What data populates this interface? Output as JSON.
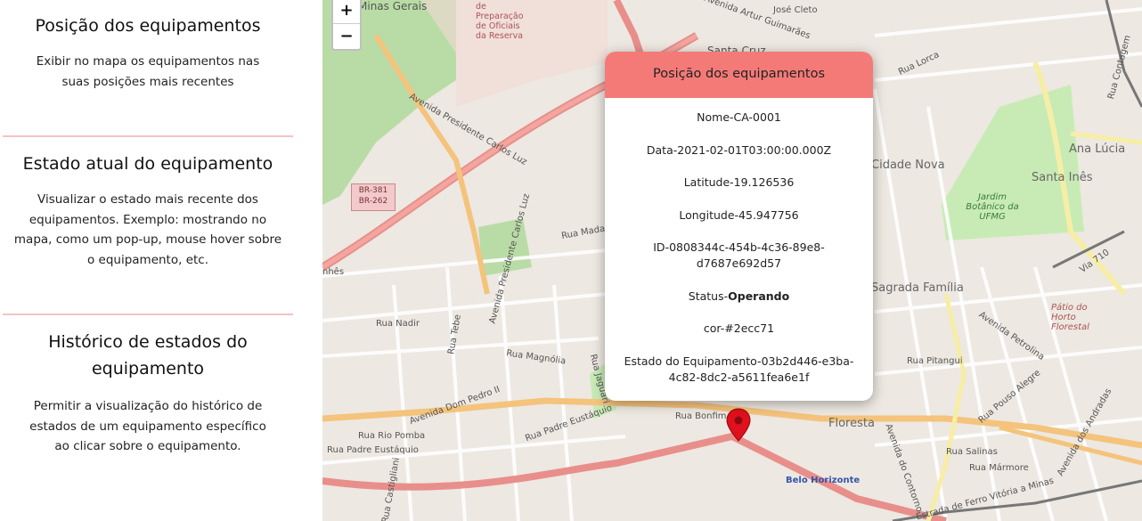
{
  "sidebar": {
    "sections": [
      {
        "title": "Posição dos equipamentos",
        "description": "Exibir no mapa os equipamentos nas suas posições mais recentes"
      },
      {
        "title": "Estado atual do equipamento",
        "description": "Visualizar o estado mais recente dos equipamentos. Exemplo: mostrando no mapa, como um pop-up, mouse hover sobre o equipamento, etc."
      },
      {
        "title": "Histórico de estados do equipamento",
        "description": "Permitir a visualização do histórico de estados de um equipamento específico ao clicar sobre o equipamento."
      }
    ]
  },
  "map": {
    "zoom_in": "+",
    "zoom_out": "−",
    "labels": {
      "minas_gerais": "Minas Gerais",
      "preparacao": "de Preparação de Oficiais da Reserva",
      "jose_cleto": "José Cleto",
      "artur": "Avenida Artur Guimarães",
      "santa_cruz": "Santa Cruz",
      "lorca": "Rua Lorca",
      "contagem": "Rua Contagem",
      "carlos_luz_1": "Avenida Presidente Carlos Luz",
      "carlos_luz_2": "Avenida Presidente Carlos Luz",
      "ana_lucia": "Ana Lúcia",
      "santa_ines": "Santa Inês",
      "cidade_nova": "Cidade Nova",
      "jardim": "Jardim Botânico da UFMG",
      "rua_madale": "Rua Madale",
      "sagrada": "Sagrada Família",
      "nadir": "Rua Nadir",
      "magnolia": "Rua Magnólia",
      "dom_pedro": "Avenida Dom Pedro II",
      "padre_eustaquio": "Rua Padre Eustáquio",
      "padre_eustaquio_2": "Rua Padre Eustáquio",
      "rio_pomba": "Rua Rio Pomba",
      "bonfim": "Rua Bonfim",
      "floresta": "Floresta",
      "petrolina": "Avenida Petrolina",
      "pitangui": "Rua Pitangui",
      "pouso_alegre": "Rua Pouso Alegre",
      "salinas": "Rua Salinas",
      "marmore": "Rua Mármore",
      "contorno": "Avenida do Contorno",
      "belo_horizonte": "Belo Horizonte",
      "patio": "Pátio do Horto Florestal",
      "ferrovia": "Estrada de Ferro Vitória a Minas",
      "via710": "Via 710",
      "andradas": "Avenida dos Andradas",
      "castigliani": "Rua Castigliani",
      "jaguari": "Rua Jaguari",
      "tebe": "Rua Tebe",
      "nhes": "nhês"
    },
    "badge": "BR-381 BR-262"
  },
  "popup": {
    "title": "Posição dos equipamentos",
    "rows": [
      {
        "label": "Nome",
        "sep": "-",
        "value": "CA-0001"
      },
      {
        "label": "Data",
        "sep": "-",
        "value": "2021-02-01T03:00:00.000Z"
      },
      {
        "label": "Latitude",
        "sep": "",
        "value": "-19.126536"
      },
      {
        "label": "Longitude",
        "sep": "",
        "value": "-45.947756"
      },
      {
        "label": "ID",
        "sep": "-",
        "value": "0808344c-454b-4c36-89e8-d7687e692d57"
      },
      {
        "label": "Status",
        "sep": "-",
        "value": "Operando"
      },
      {
        "label": "cor",
        "sep": "-",
        "value": "#2ecc71"
      },
      {
        "label": "Estado do Equipamento",
        "sep": "-",
        "value": "03b2d446-e3ba-4c82-8dc2-a5611fea6e1f"
      }
    ]
  },
  "colors": {
    "popup_header": "#f47a78",
    "marker": "#e0101c",
    "divider": "#f6c2c2"
  }
}
